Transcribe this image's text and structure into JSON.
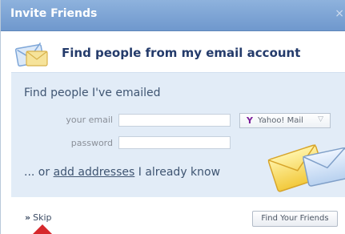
{
  "dialog": {
    "title": "Invite Friends",
    "close_symbol": "×",
    "header_icon": "envelope-icon",
    "header_text": "Find people from my email account"
  },
  "form": {
    "section_title": "Find people I've emailed",
    "email_label": "your email",
    "email_value": "",
    "password_label": "password",
    "password_value": "",
    "provider_selected": "Yahoo! Mail",
    "provider_icon": "yahoo-icon"
  },
  "alternative": {
    "prefix": "... or ",
    "link_text": "add addresses",
    "suffix": " I already know"
  },
  "footer": {
    "skip_arrows": "»",
    "skip_label": "Skip",
    "find_button_label": "Find Your Friends"
  },
  "colors": {
    "title_bar": "#7aa3d6",
    "panel_bg": "#e2ecf7",
    "header_text": "#243b6b",
    "pointer_arrow": "#d6282c"
  }
}
